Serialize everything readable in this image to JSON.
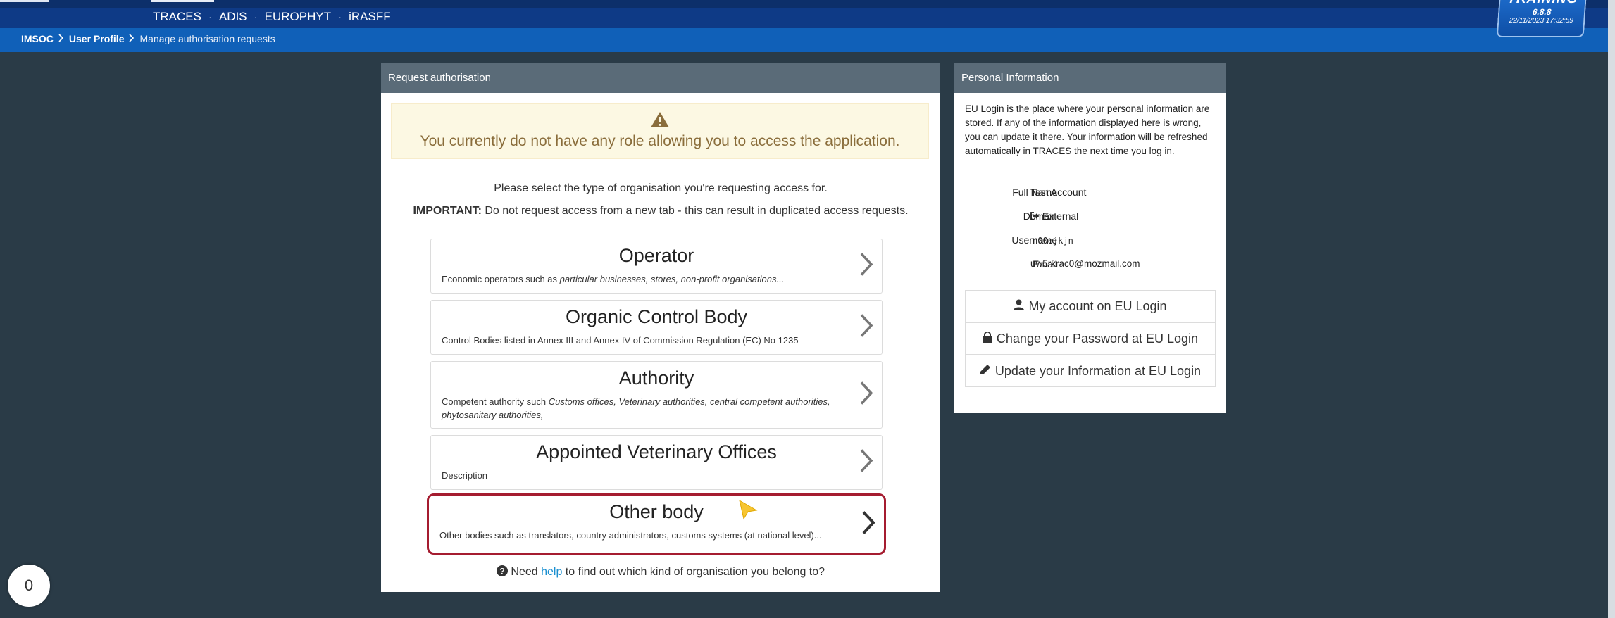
{
  "header": {
    "app_links": [
      "TRACES",
      "ADIS",
      "EUROPHYT",
      "iRASFF"
    ],
    "separator": "·"
  },
  "breadcrumb": {
    "root": "IMSOC",
    "profile": "User Profile",
    "current": "Manage authorisation requests"
  },
  "training_badge": {
    "label": "TRAINING",
    "version": "6.8.8",
    "timestamp": "22/11/2023 17:32:59"
  },
  "request_panel": {
    "title": "Request authorisation",
    "warning": "You currently do not have any role allowing you to access the application.",
    "intro": "Please select the type of organisation you're requesting access for.",
    "important_label": "IMPORTANT:",
    "important_text": "Do not request access from a new tab - this can result in duplicated access requests.",
    "organisations": [
      {
        "title": "Operator",
        "desc_plain": "Economic operators such as ",
        "desc_italic": "particular businesses, stores, non-profit organisations..."
      },
      {
        "title": "Organic Control Body",
        "desc_plain": "Control Bodies listed in Annex III and Annex IV of Commission Regulation (EC) No 1235",
        "desc_italic": ""
      },
      {
        "title": "Authority",
        "desc_plain": "Competent authority such ",
        "desc_italic": "Customs offices, Veterinary authorities, central competent authorities, phytosanitary authorities,"
      },
      {
        "title": "Appointed Veterinary Offices",
        "desc_plain": "Description",
        "desc_italic": ""
      },
      {
        "title": "Other body",
        "desc_plain": "Other bodies such as translators, country administrators, customs systems (at national level)...",
        "desc_italic": ""
      }
    ],
    "help_prefix": "Need",
    "help_link": "help",
    "help_suffix": "to find out which kind of organisation you belong to?"
  },
  "personal_panel": {
    "title": "Personal Information",
    "description": "EU Login is the place where your personal information are stored. If any of the information displayed here is wrong, you can update it there. Your information will be refreshed automatically in TRACES the next time you log in.",
    "fields": {
      "full_name_label": "Full Name",
      "full_name": "Test Account",
      "domain_label": "Domain",
      "domain": "External",
      "username_label": "Username",
      "username": "n00ejkjn",
      "email_label": "Email",
      "email": "uw5rkrac0@mozmail.com"
    },
    "buttons": {
      "account": "My account on EU Login",
      "password": "Change your Password at EU Login",
      "update": "Update your Information at EU Login"
    }
  },
  "counter": "0",
  "colors": {
    "page_bg": "#2a3b47",
    "nav_blue": "#0e3a86",
    "breadcrumb_blue": "#1060b8",
    "panel_header": "#5a6b78",
    "selected_border": "#a51c30",
    "warning_bg": "#fcf8e3"
  }
}
